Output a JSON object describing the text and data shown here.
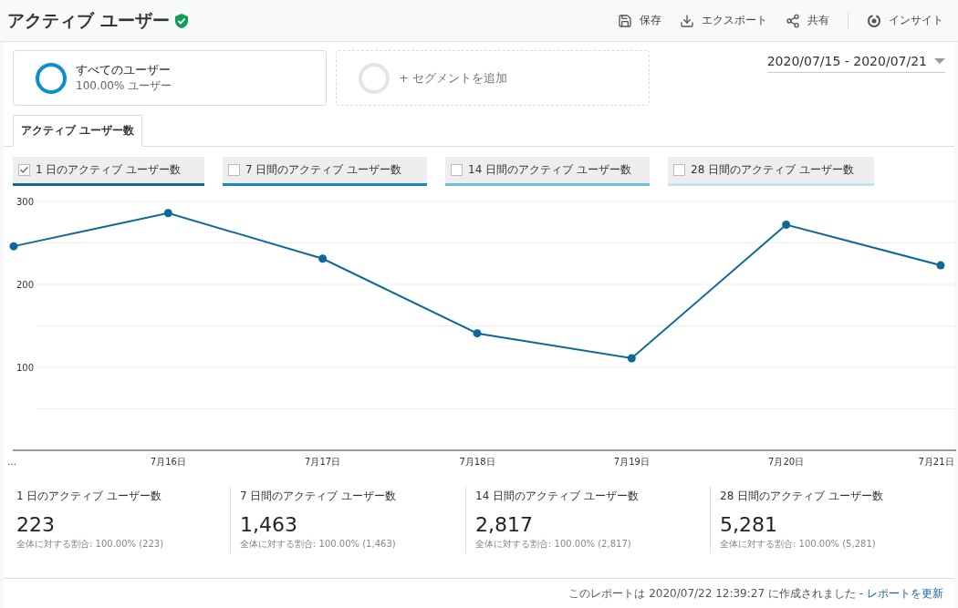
{
  "header": {
    "title": "アクティブ ユーザー",
    "verified": true,
    "actions": [
      {
        "kind": "save",
        "label": "保存"
      },
      {
        "kind": "export",
        "label": "エクスポート"
      },
      {
        "kind": "share",
        "label": "共有"
      },
      {
        "kind": "insight",
        "label": "インサイト"
      }
    ]
  },
  "segments": [
    {
      "kind": "segment",
      "name": "すべてのユーザー",
      "sub": "100.00% ユーザー"
    },
    {
      "kind": "add",
      "name": "+ セグメントを追加"
    }
  ],
  "date_range": "2020/07/15 - 2020/07/21",
  "tabs": [
    {
      "label": "アクティブ ユーザー数",
      "selected": true
    }
  ],
  "metrics": [
    {
      "label": "1 日のアクティブ ユーザー数",
      "checked": true,
      "color": "#0d6a96"
    },
    {
      "label": "7 日間のアクティブ ユーザー数",
      "checked": false,
      "color": "#1a87c0"
    },
    {
      "label": "14 日間のアクティブ ユーザー数",
      "checked": false,
      "color": "#74bde0"
    },
    {
      "label": "28 日間のアクティブ ユーザー数",
      "checked": false,
      "color": "#c2e2ef"
    }
  ],
  "chart_data": {
    "type": "line",
    "categories": [
      "…",
      "7月16日",
      "7月17日",
      "7月18日",
      "7月19日",
      "7月20日",
      "7月21日"
    ],
    "ylim": [
      0,
      300
    ],
    "yticks": [
      100,
      200,
      300
    ],
    "series": [
      {
        "color": "#0d6a96",
        "marker": "circle",
        "values": [
          246,
          286,
          231,
          141,
          111,
          272,
          223
        ]
      }
    ]
  },
  "summary": [
    {
      "label": "1 日のアクティブ ユーザー数",
      "value": "223",
      "share": "全体に対する割合: 100.00% (223)"
    },
    {
      "label": "7 日間のアクティブ ユーザー数",
      "value": "1,463",
      "share": "全体に対する割合: 100.00% (1,463)"
    },
    {
      "label": "14 日間のアクティブ ユーザー数",
      "value": "2,817",
      "share": "全体に対する割合: 100.00% (2,817)"
    },
    {
      "label": "28 日間のアクティブ ユーザー数",
      "value": "5,281",
      "share": "全体に対する割合: 100.00% (5,281)"
    }
  ],
  "footer": {
    "note": "このレポートは 2020/07/22 12:39:27 に作成されました -",
    "link": "レポートを更新"
  }
}
